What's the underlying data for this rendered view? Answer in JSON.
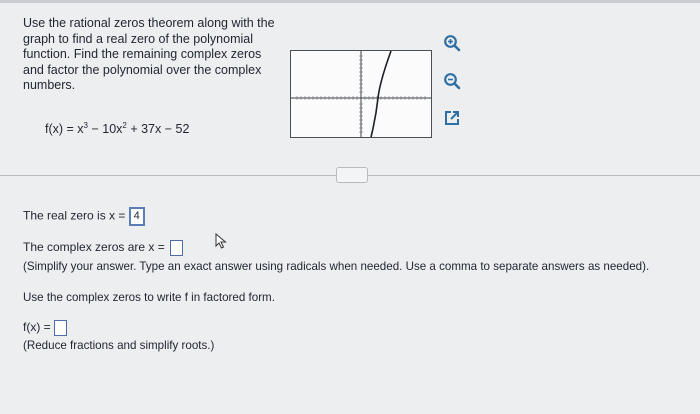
{
  "problem": {
    "instruction": "Use the rational zeros theorem along with the graph to find a real zero of the polynomial function. Find the remaining complex zeros and factor the polynomial over the complex numbers.",
    "formula_prefix": "f(x) = x",
    "exp1": "3",
    "formula_mid": " − 10x",
    "exp2": "2",
    "formula_suffix": " + 37x − 52"
  },
  "icons": {
    "zoom_in": "zoom-in-icon",
    "zoom_out": "zoom-out-icon",
    "popout": "external-link-icon"
  },
  "answers": {
    "real_zero_label": "The real zero is x =",
    "real_zero_value": "4",
    "complex_label": "The complex zeros are x =",
    "complex_instructions": "(Simplify your answer. Type an exact answer using radicals when needed. Use a comma to separate answers as needed).",
    "factor_prompt": "Use the complex zeros to write f in factored form.",
    "fx_label": "f(x) =",
    "fx_instructions": "(Reduce fractions and simplify roots.)"
  },
  "colors": {
    "accent": "#5a7fb8",
    "icon": "#2f6fa3"
  }
}
